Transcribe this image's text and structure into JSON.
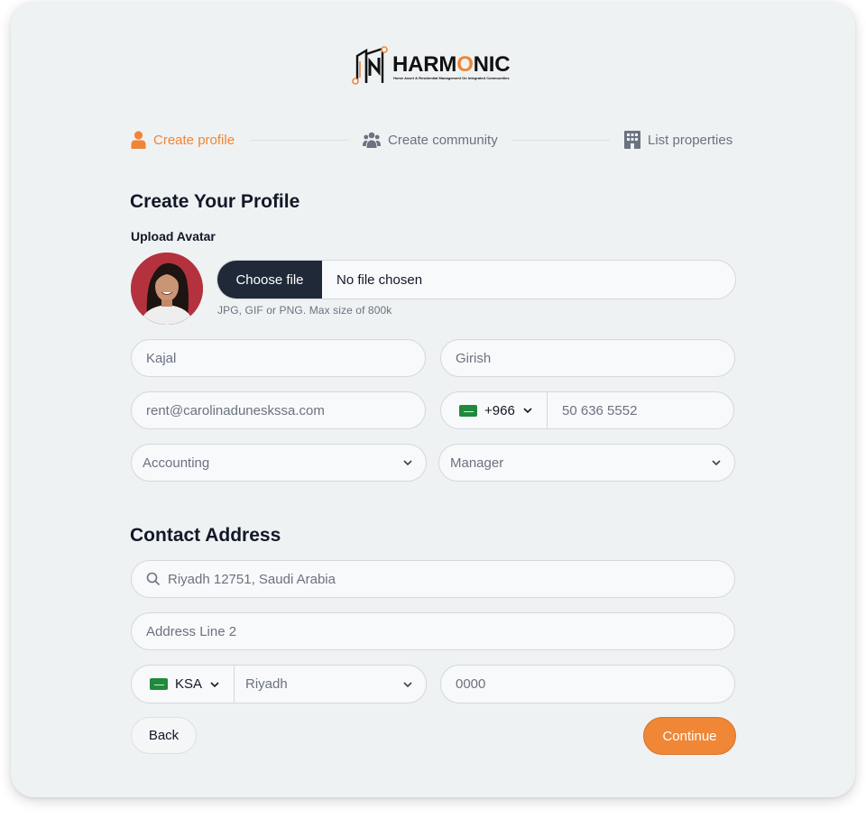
{
  "brand": {
    "name_part1": "HARM",
    "name_o": "O",
    "name_part2": "NIC",
    "tagline": "Home Asset & Residential Management On Integrated Communities",
    "accent": "#ee8537"
  },
  "stepper": [
    {
      "label": "Create profile",
      "icon": "user-icon",
      "active": true
    },
    {
      "label": "Create community",
      "icon": "users-icon",
      "active": false
    },
    {
      "label": "List properties",
      "icon": "building-icon",
      "active": false
    }
  ],
  "profile": {
    "title": "Create Your Profile",
    "avatar_label": "Upload Avatar",
    "file_button": "Choose file",
    "file_status": "No file chosen",
    "file_hint": "JPG, GIF or PNG. Max size of 800k",
    "first_name": "Kajal",
    "last_name": "Girish",
    "email": "rent@carolinaduneskssa.com",
    "phone_code": "+966",
    "phone_number": "50 636 5552",
    "department": "Accounting",
    "role": "Manager"
  },
  "address": {
    "title": "Contact Address",
    "line1": "Riyadh 12751, Saudi Arabia",
    "line2_placeholder": "Address Line 2",
    "country": "KSA",
    "city": "Riyadh",
    "postal_placeholder": "0000"
  },
  "actions": {
    "back": "Back",
    "continue": "Continue"
  }
}
